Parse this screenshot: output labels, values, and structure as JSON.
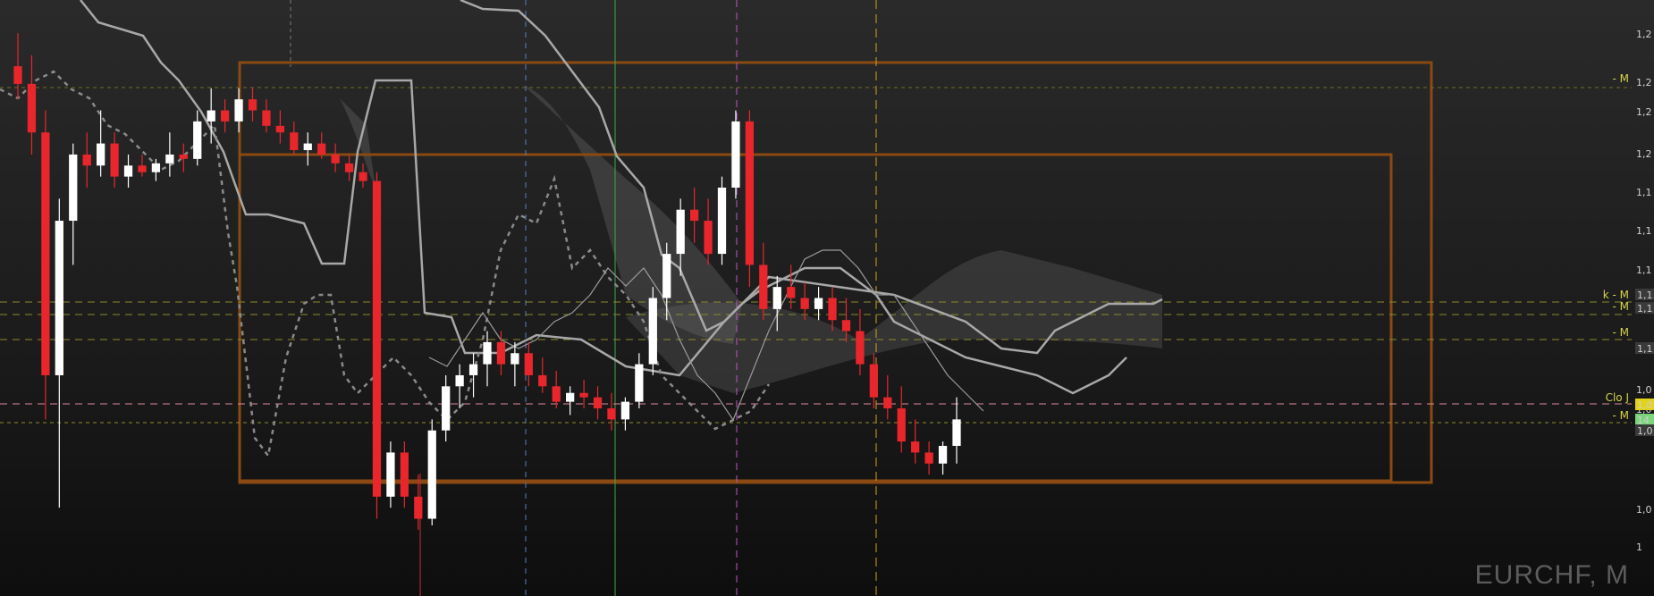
{
  "chart_data": {
    "type": "candlestick",
    "symbol": "EURCHF, M",
    "candles": [
      [
        1.22,
        1.235,
        1.205,
        1.212
      ],
      [
        1.212,
        1.225,
        1.18,
        1.19
      ],
      [
        1.19,
        1.2,
        1.06,
        1.08
      ],
      [
        1.08,
        1.16,
        1.02,
        1.15
      ],
      [
        1.15,
        1.185,
        1.13,
        1.18
      ],
      [
        1.18,
        1.19,
        1.165,
        1.175
      ],
      [
        1.175,
        1.2,
        1.17,
        1.185
      ],
      [
        1.185,
        1.19,
        1.165,
        1.17
      ],
      [
        1.17,
        1.18,
        1.165,
        1.175
      ],
      [
        1.175,
        1.18,
        1.17,
        1.172
      ],
      [
        1.172,
        1.178,
        1.168,
        1.176
      ],
      [
        1.176,
        1.19,
        1.17,
        1.18
      ],
      [
        1.18,
        1.185,
        1.172,
        1.178
      ],
      [
        1.178,
        1.2,
        1.175,
        1.195
      ],
      [
        1.195,
        1.21,
        1.185,
        1.2
      ],
      [
        1.2,
        1.205,
        1.19,
        1.195
      ],
      [
        1.195,
        1.21,
        1.19,
        1.205
      ],
      [
        1.205,
        1.21,
        1.195,
        1.2
      ],
      [
        1.2,
        1.205,
        1.19,
        1.193
      ],
      [
        1.193,
        1.2,
        1.185,
        1.19
      ],
      [
        1.19,
        1.195,
        1.18,
        1.182
      ],
      [
        1.182,
        1.19,
        1.175,
        1.185
      ],
      [
        1.185,
        1.19,
        1.178,
        1.18
      ],
      [
        1.18,
        1.185,
        1.172,
        1.176
      ],
      [
        1.176,
        1.18,
        1.168,
        1.172
      ],
      [
        1.172,
        1.176,
        1.165,
        1.168
      ],
      [
        1.168,
        1.172,
        1.015,
        1.025
      ],
      [
        1.025,
        1.05,
        1.02,
        1.045
      ],
      [
        1.045,
        1.05,
        1.02,
        1.025
      ],
      [
        1.025,
        1.035,
        1.01,
        1.015
      ],
      [
        1.015,
        1.06,
        1.012,
        1.055
      ],
      [
        1.055,
        1.08,
        1.05,
        1.075
      ],
      [
        1.075,
        1.085,
        1.065,
        1.08
      ],
      [
        1.08,
        1.09,
        1.07,
        1.085
      ],
      [
        1.085,
        1.1,
        1.075,
        1.095
      ],
      [
        1.095,
        1.1,
        1.08,
        1.085
      ],
      [
        1.085,
        1.095,
        1.075,
        1.09
      ],
      [
        1.09,
        1.095,
        1.075,
        1.08
      ],
      [
        1.08,
        1.088,
        1.072,
        1.075
      ],
      [
        1.075,
        1.082,
        1.065,
        1.068
      ],
      [
        1.068,
        1.075,
        1.062,
        1.072
      ],
      [
        1.072,
        1.078,
        1.065,
        1.07
      ],
      [
        1.07,
        1.075,
        1.06,
        1.065
      ],
      [
        1.065,
        1.072,
        1.055,
        1.06
      ],
      [
        1.06,
        1.07,
        1.055,
        1.068
      ],
      [
        1.068,
        1.09,
        1.065,
        1.085
      ],
      [
        1.085,
        1.12,
        1.08,
        1.115
      ],
      [
        1.115,
        1.14,
        1.105,
        1.135
      ],
      [
        1.135,
        1.16,
        1.125,
        1.155
      ],
      [
        1.155,
        1.165,
        1.14,
        1.15
      ],
      [
        1.15,
        1.16,
        1.13,
        1.135
      ],
      [
        1.135,
        1.17,
        1.13,
        1.165
      ],
      [
        1.165,
        1.2,
        1.16,
        1.195
      ],
      [
        1.195,
        1.2,
        1.12,
        1.13
      ],
      [
        1.13,
        1.14,
        1.105,
        1.11
      ],
      [
        1.11,
        1.125,
        1.1,
        1.12
      ],
      [
        1.12,
        1.13,
        1.11,
        1.115
      ],
      [
        1.115,
        1.122,
        1.105,
        1.11
      ],
      [
        1.11,
        1.12,
        1.105,
        1.115
      ],
      [
        1.115,
        1.12,
        1.1,
        1.105
      ],
      [
        1.105,
        1.115,
        1.095,
        1.1
      ],
      [
        1.1,
        1.11,
        1.08,
        1.085
      ],
      [
        1.085,
        1.09,
        1.065,
        1.07
      ],
      [
        1.07,
        1.08,
        1.06,
        1.065
      ],
      [
        1.065,
        1.075,
        1.045,
        1.05
      ],
      [
        1.05,
        1.06,
        1.04,
        1.045
      ],
      [
        1.045,
        1.05,
        1.035,
        1.04
      ],
      [
        1.04,
        1.05,
        1.035,
        1.048
      ],
      [
        1.048,
        1.07,
        1.04,
        1.06
      ]
    ],
    "ylim": [
      0.98,
      1.25
    ],
    "y_tick_labels": [
      "1,2",
      "1,2",
      "1,2",
      "1,2",
      "1,1",
      "1,1",
      "1,1",
      "1,1",
      "1,1",
      "1,0",
      "1,0",
      "1,0",
      "1,0",
      "1"
    ],
    "level_labels": [
      "- M",
      "k - M",
      "- M",
      "- M",
      "Clo J",
      "- M"
    ],
    "price_tags": [
      "1,1",
      "1,1",
      "1,1",
      "1,0",
      "14",
      "1,0"
    ],
    "colors": {
      "up": "#ffffff",
      "down": "#e8262c",
      "box": "#8a4a12",
      "level": "#8c8c2a",
      "close": "#e08a9a",
      "cloud": "#6e6e6e"
    }
  }
}
